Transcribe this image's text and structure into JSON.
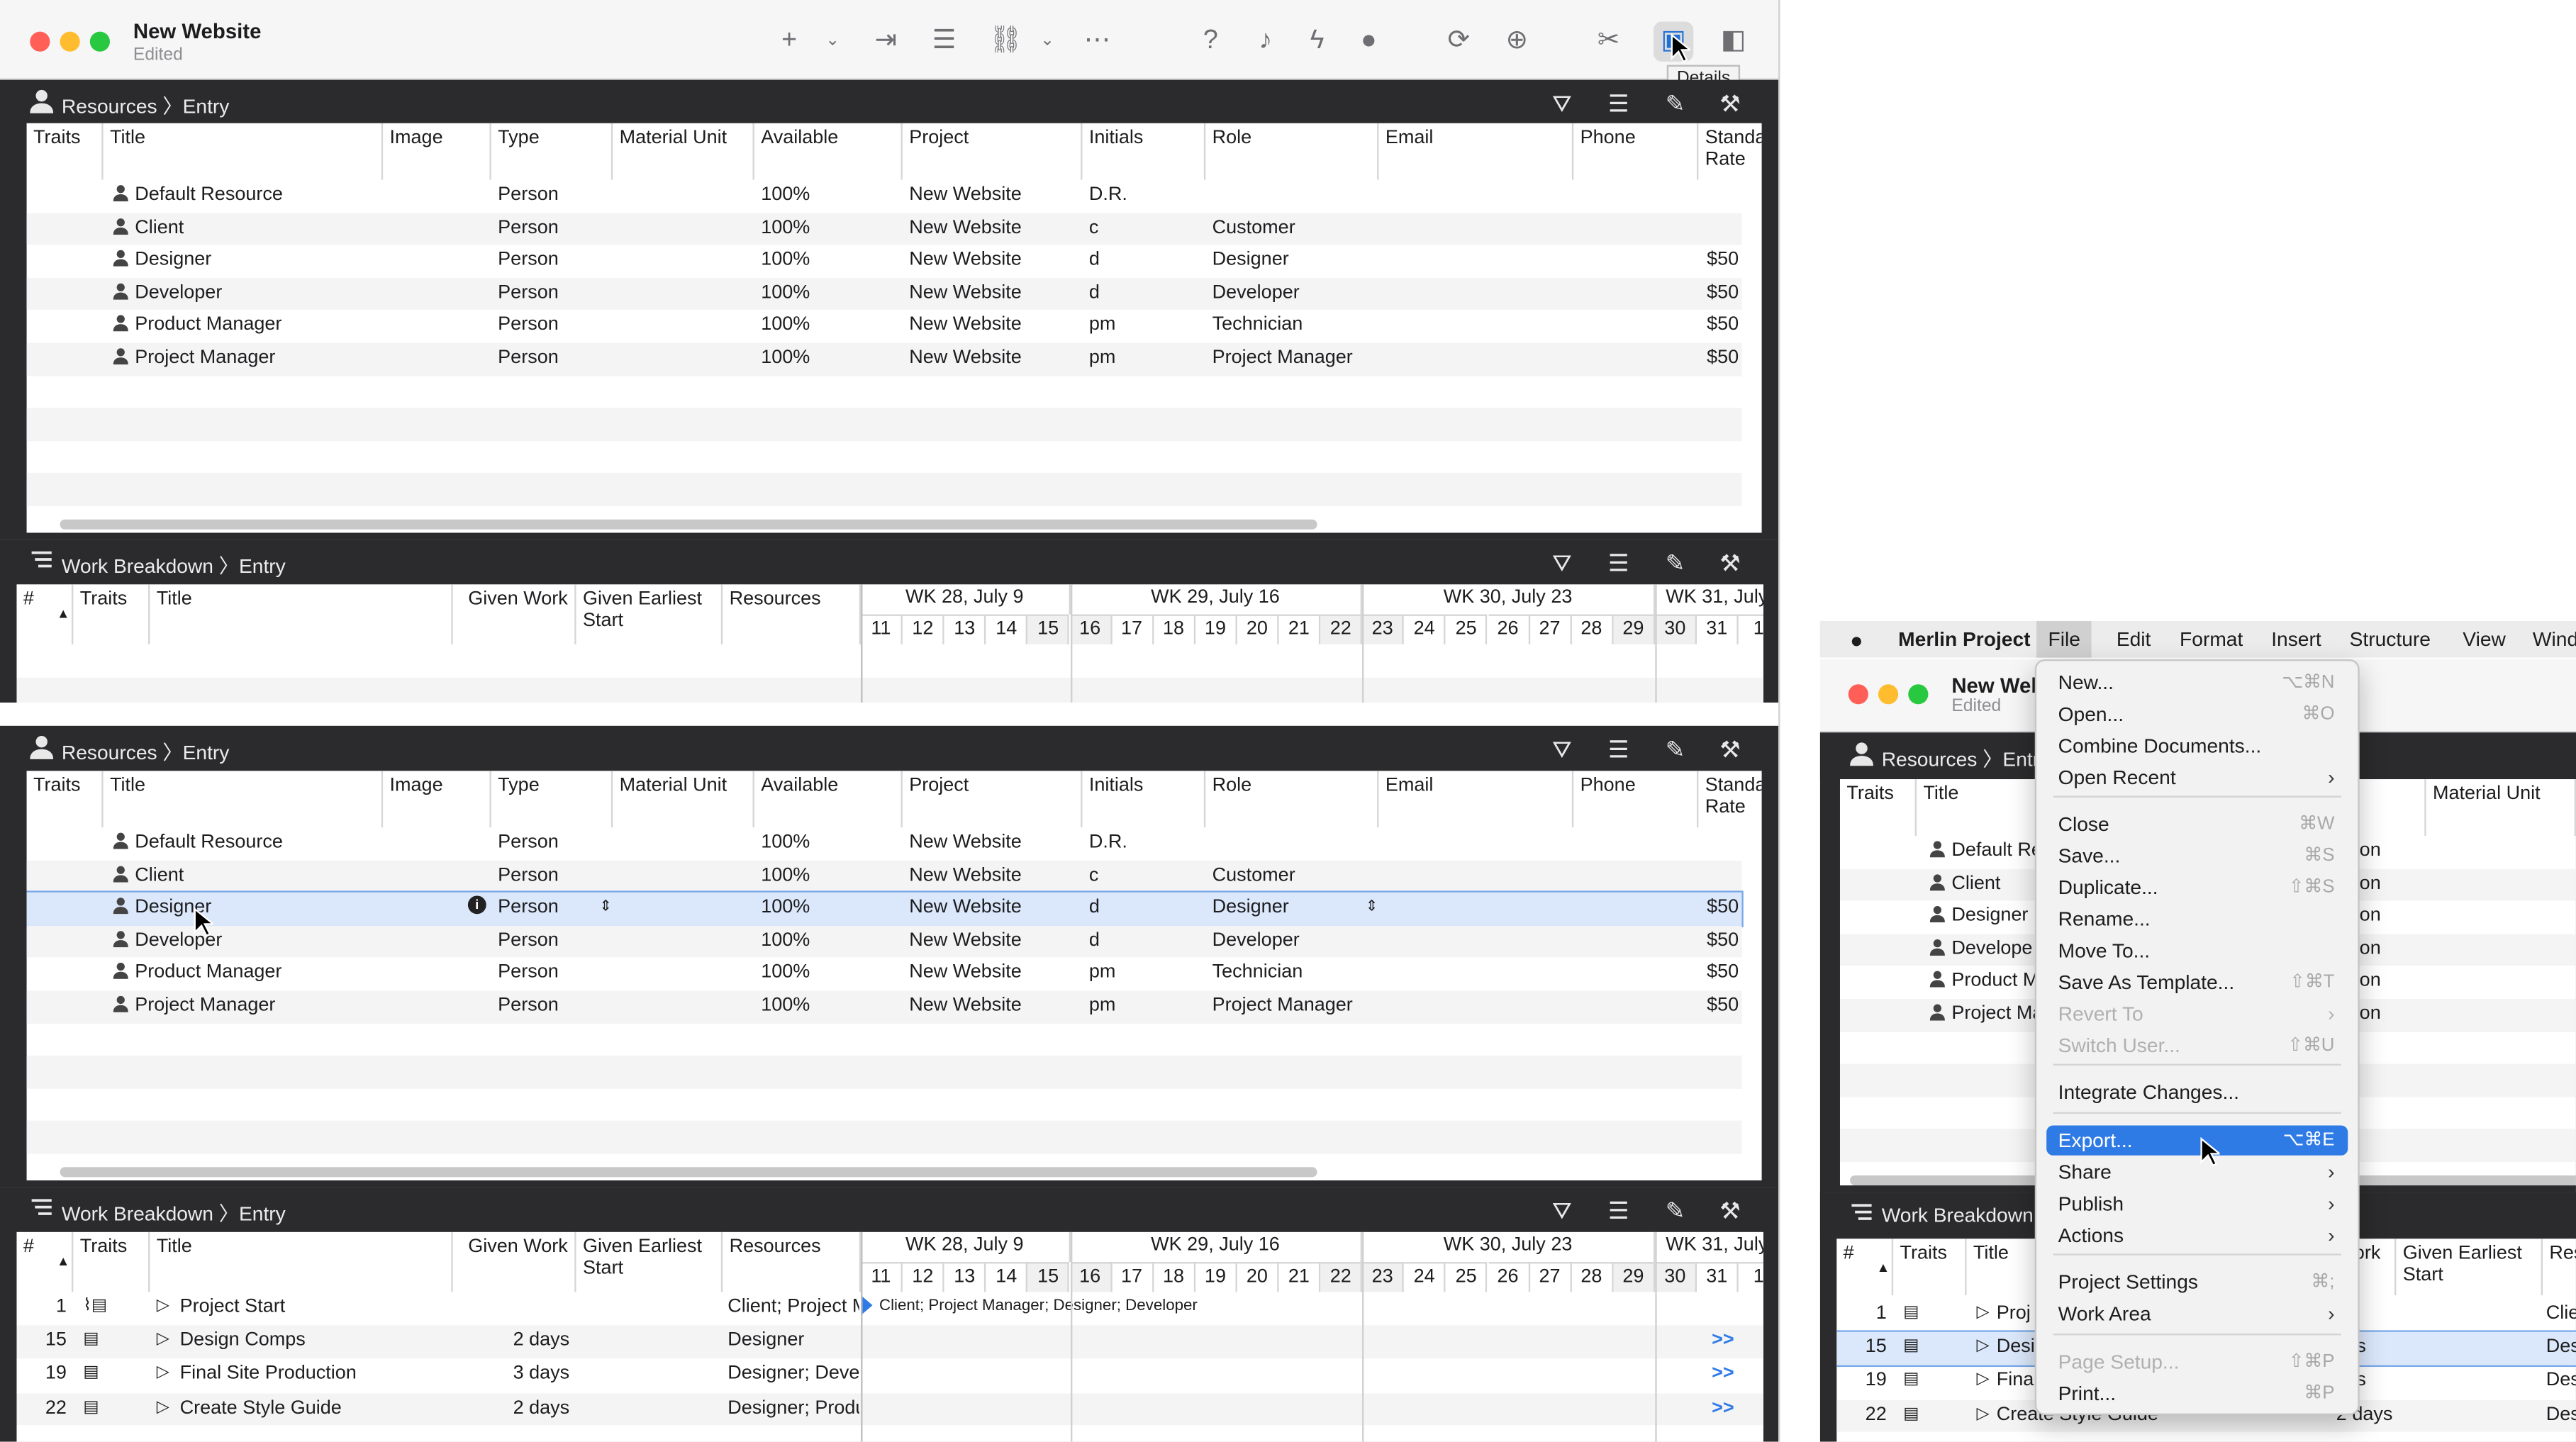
{
  "window": {
    "title": "New Website",
    "subtitle": "Edited",
    "tooltip": "Details"
  },
  "resources_pane": {
    "breadcrumb_root": "Resources",
    "breadcrumb_leaf": "Entry",
    "columns": [
      "Traits",
      "Title",
      "Image",
      "Type",
      "Material Unit",
      "Available",
      "Project",
      "Initials",
      "Role",
      "Email",
      "Phone",
      "Standa Rate"
    ],
    "rows": [
      {
        "title": "Default Resource",
        "type": "Person",
        "available": "100%",
        "project": "New Website",
        "initials": "D.R.",
        "role": "",
        "rate": ""
      },
      {
        "title": "Client",
        "type": "Person",
        "available": "100%",
        "project": "New Website",
        "initials": "c",
        "role": "Customer",
        "rate": ""
      },
      {
        "title": "Designer",
        "type": "Person",
        "available": "100%",
        "project": "New Website",
        "initials": "d",
        "role": "Designer",
        "rate": "$50"
      },
      {
        "title": "Developer",
        "type": "Person",
        "available": "100%",
        "project": "New Website",
        "initials": "d",
        "role": "Developer",
        "rate": "$50"
      },
      {
        "title": "Product Manager",
        "type": "Person",
        "available": "100%",
        "project": "New Website",
        "initials": "pm",
        "role": "Technician",
        "rate": "$50"
      },
      {
        "title": "Project Manager",
        "type": "Person",
        "available": "100%",
        "project": "New Website",
        "initials": "pm",
        "role": "Project Manager",
        "rate": "$50"
      }
    ]
  },
  "work_pane": {
    "breadcrumb_root": "Work Breakdown",
    "breadcrumb_leaf": "Entry",
    "columns": [
      "#",
      "Traits",
      "Title",
      "Given Work",
      "Given Earliest Start",
      "Resources"
    ],
    "weeks": [
      "WK 28, July 9",
      "WK 29, July 16",
      "WK 30, July 23",
      "WK 31, July"
    ],
    "days": [
      "11",
      "12",
      "13",
      "14",
      "15",
      "16",
      "17",
      "18",
      "19",
      "20",
      "21",
      "22",
      "23",
      "24",
      "25",
      "26",
      "27",
      "28",
      "29",
      "30",
      "31",
      "1"
    ],
    "rows": [
      {
        "num": "1",
        "title": "Project Start",
        "work": "",
        "resources": "Client; Project M",
        "bar_label": "Client; Project Manager; Designer; Developer"
      },
      {
        "num": "15",
        "title": "Design Comps",
        "work": "2 days",
        "resources": "Designer",
        "bar_label": ""
      },
      {
        "num": "19",
        "title": "Final Site Production",
        "work": "3 days",
        "resources": "Designer; Devel",
        "bar_label": ""
      },
      {
        "num": "22",
        "title": "Create Style Guide",
        "work": "2 days",
        "resources": "Designer; Produ",
        "bar_label": ""
      }
    ],
    "more_glyph": ">>"
  },
  "right_window": {
    "menubar": [
      "Merlin Project",
      "File",
      "Edit",
      "Format",
      "Insert",
      "Structure",
      "View",
      "Wind"
    ],
    "title": "New Web",
    "subtitle": "Edited",
    "res_rows": [
      "Default Re",
      "Client",
      "Designer",
      "Develope",
      "Product M",
      "Project Ma"
    ],
    "res_trunc": [
      "on",
      "on",
      "on",
      "on",
      "on",
      "on"
    ],
    "res_cols": [
      "Traits",
      "Title",
      "Material Unit"
    ],
    "res_breadcrumb": "Resources",
    "res_breadcrumb_leaf": "Entry",
    "work_breadcrumb": "Work Breakdown",
    "work_cols": [
      "#",
      "Traits",
      "Title",
      "Work",
      "Given Earliest Start",
      "Res"
    ],
    "work_rows": [
      {
        "num": "1",
        "title": "Proj",
        "work": "",
        "res": "Clie"
      },
      {
        "num": "15",
        "title": "Desi",
        "work": "ays",
        "res": "Des"
      },
      {
        "num": "19",
        "title": "Fina",
        "work": "ays",
        "res": "Des"
      },
      {
        "num": "22",
        "title": "Create Style Guide",
        "work": "2 days",
        "res": "Des"
      }
    ]
  },
  "file_menu": {
    "items": [
      {
        "label": "New...",
        "shortcut": "⌥⌘N",
        "disabled": false,
        "submenu": false
      },
      {
        "label": "Open...",
        "shortcut": "⌘O",
        "disabled": false,
        "submenu": false
      },
      {
        "label": "Combine Documents...",
        "shortcut": "",
        "disabled": false,
        "submenu": false
      },
      {
        "label": "Open Recent",
        "shortcut": "",
        "disabled": false,
        "submenu": true
      },
      {
        "label": "Close",
        "shortcut": "⌘W",
        "disabled": false,
        "submenu": false
      },
      {
        "label": "Save...",
        "shortcut": "⌘S",
        "disabled": false,
        "submenu": false
      },
      {
        "label": "Duplicate...",
        "shortcut": "⇧⌘S",
        "disabled": false,
        "submenu": false
      },
      {
        "label": "Rename...",
        "shortcut": "",
        "disabled": false,
        "submenu": false
      },
      {
        "label": "Move To...",
        "shortcut": "",
        "disabled": false,
        "submenu": false
      },
      {
        "label": "Save As Template...",
        "shortcut": "⇧⌘T",
        "disabled": false,
        "submenu": false
      },
      {
        "label": "Revert To",
        "shortcut": "",
        "disabled": true,
        "submenu": true
      },
      {
        "label": "Switch User...",
        "shortcut": "⇧⌘U",
        "disabled": true,
        "submenu": false
      },
      {
        "label": "Integrate Changes...",
        "shortcut": "",
        "disabled": false,
        "submenu": false
      },
      {
        "label": "Export...",
        "shortcut": "⌥⌘E",
        "disabled": false,
        "submenu": false,
        "highlighted": true
      },
      {
        "label": "Share",
        "shortcut": "",
        "disabled": false,
        "submenu": true
      },
      {
        "label": "Publish",
        "shortcut": "",
        "disabled": false,
        "submenu": true
      },
      {
        "label": "Actions",
        "shortcut": "",
        "disabled": false,
        "submenu": true
      },
      {
        "label": "Project Settings",
        "shortcut": "⌘;",
        "disabled": false,
        "submenu": false
      },
      {
        "label": "Work Area",
        "shortcut": "",
        "disabled": false,
        "submenu": true
      },
      {
        "label": "Page Setup...",
        "shortcut": "⇧⌘P",
        "disabled": true,
        "submenu": false
      },
      {
        "label": "Print...",
        "shortcut": "⌘P",
        "disabled": false,
        "submenu": false
      }
    ]
  },
  "colors": {
    "accent": "#2f7be6",
    "pane_header": "#2b2b2d",
    "selection": "#dbe8fb"
  }
}
